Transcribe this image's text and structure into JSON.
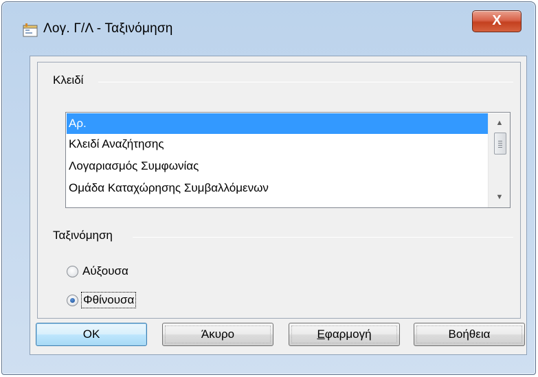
{
  "window": {
    "title": "Λογ. Γ/Λ - Ταξινόμηση",
    "close_label": "X"
  },
  "key_section": {
    "label": "Κλειδί",
    "items": [
      {
        "label": "Αρ.",
        "selected": true
      },
      {
        "label": "Κλειδί Αναζήτησης",
        "selected": false
      },
      {
        "label": "Λογαριασμός Συμφωνίας",
        "selected": false
      },
      {
        "label": "Ομάδα Καταχώρησης Συμβαλλόμενων",
        "selected": false
      }
    ]
  },
  "sort_section": {
    "label": "Ταξινόμηση",
    "options": [
      {
        "label": "Αύξουσα",
        "checked": false
      },
      {
        "label": "Φθίνουσα",
        "checked": true
      }
    ]
  },
  "buttons": {
    "ok": "OK",
    "cancel": "Άκυρο",
    "apply_first": "Ε",
    "apply_rest": "φαρμογή",
    "help": "Βοήθεια"
  },
  "colors": {
    "selection": "#3399ff",
    "close_button": "#c4401f",
    "title_bar": "#c4d8ee"
  }
}
